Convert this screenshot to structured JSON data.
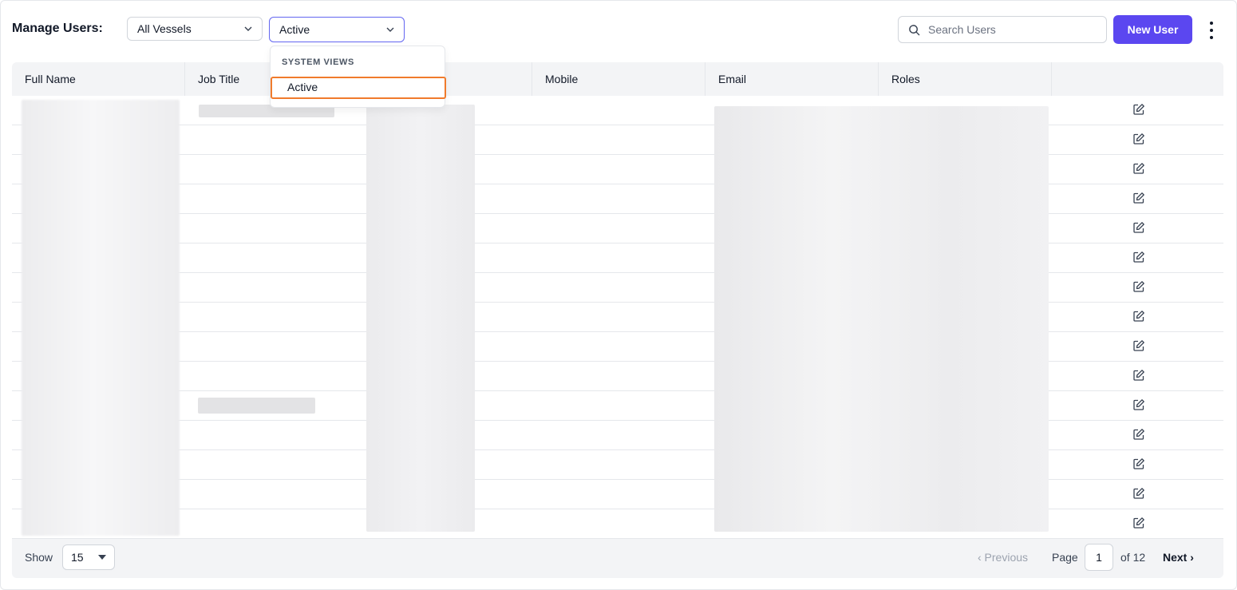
{
  "header": {
    "title": "Manage Users:",
    "vessel_filter": "All Vessels",
    "status_filter": "Active",
    "search_placeholder": "Search Users",
    "new_user_label": "New User"
  },
  "dropdown": {
    "section_label": "SYSTEM VIEWS",
    "items": [
      "Active"
    ],
    "highlight_color": "#f07b2c"
  },
  "table": {
    "columns": [
      "Full Name",
      "Job Title",
      "",
      "Mobile",
      "Email",
      "Roles",
      ""
    ],
    "row_count": 15,
    "row_action_icon": "edit-icon"
  },
  "footer": {
    "show_label": "Show",
    "page_size": "15",
    "previous_label": "‹ Previous",
    "page_label": "Page",
    "current_page": "1",
    "of_label": "of 12",
    "next_label": "Next ›"
  },
  "colors": {
    "accent": "#5b47f0",
    "focus_border": "#6366f1",
    "header_bg": "#f3f4f6"
  }
}
